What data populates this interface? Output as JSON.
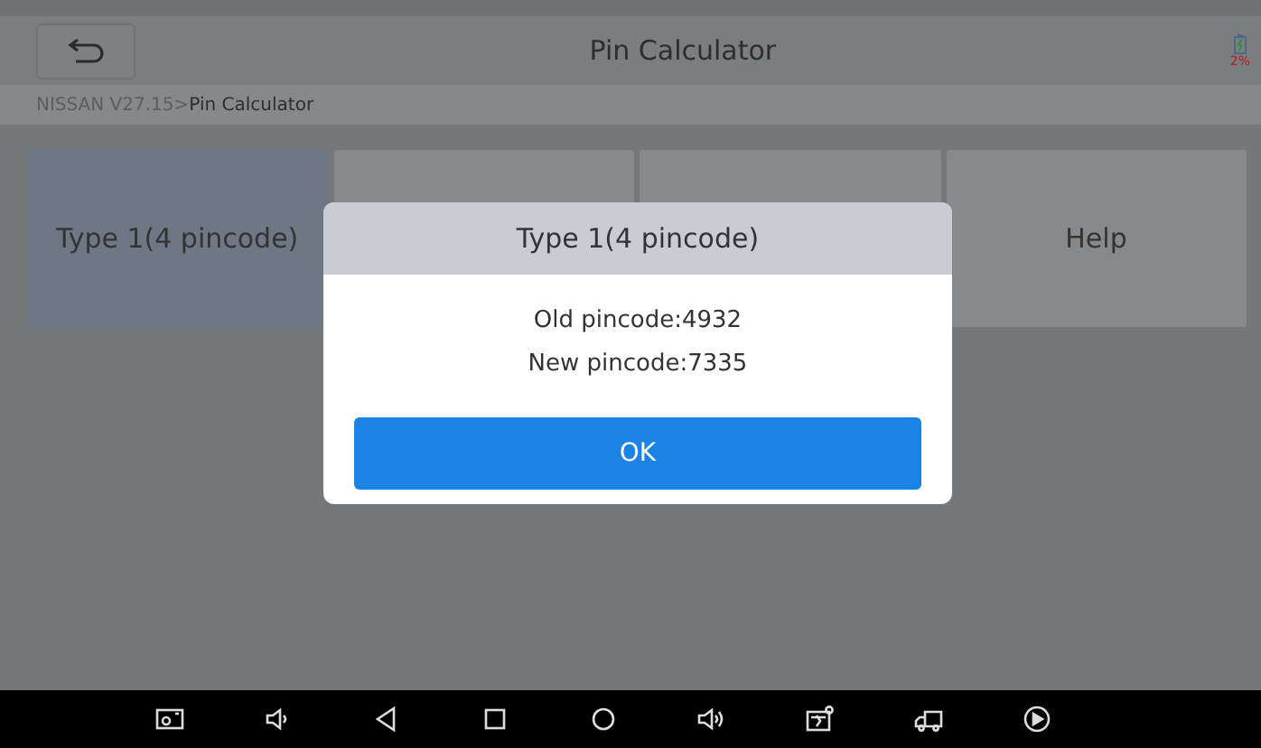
{
  "header": {
    "title": "Pin Calculator",
    "battery": "2%"
  },
  "breadcrumb": {
    "path": "NISSAN V27.15>",
    "current": "Pin Calculator"
  },
  "tiles": [
    {
      "label": "Type 1(4 pincode)",
      "selected": true
    },
    {
      "selected": false
    },
    {
      "selected": false
    },
    {
      "label": "Help",
      "selected": false
    }
  ],
  "dialog": {
    "title": "Type 1(4 pincode)",
    "lines": [
      "Old pincode:4932",
      "New pincode:7335"
    ],
    "button": "OK"
  }
}
